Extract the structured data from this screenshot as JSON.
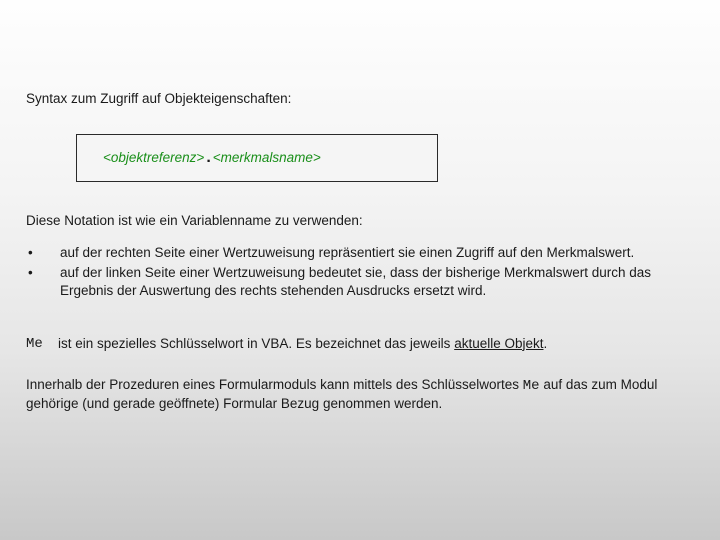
{
  "intro": "Syntax zum Zugriff auf Objekteigenschaften:",
  "syntax": {
    "left": "<objektreferenz>",
    "dot": ".",
    "right": "<merkmalsname>"
  },
  "note": "Diese Notation ist wie ein Variablenname zu verwenden:",
  "bullets": [
    "auf der rechten Seite einer Wertzuweisung repräsentiert sie einen Zugriff auf den Merkmalswert.",
    "auf der linken Seite einer Wertzuweisung bedeutet sie, dass der bisherige Merkmalswert durch das Ergebnis der Auswertung des rechts stehenden Ausdrucks ersetzt wird."
  ],
  "me": {
    "keyword": "Me",
    "before": "ist ein spezielles Schlüsselwort in VBA. Es bezeichnet das jeweils ",
    "underlined": "aktuelle Objekt",
    "after": "."
  },
  "final": {
    "before": "Innerhalb der Prozeduren eines Formularmoduls kann mittels des Schlüsselwortes ",
    "keyword": "Me",
    "after": " auf das zum Modul gehörige (und gerade geöffnete) Formular Bezug genommen werden."
  },
  "bullet_symbol": "•"
}
